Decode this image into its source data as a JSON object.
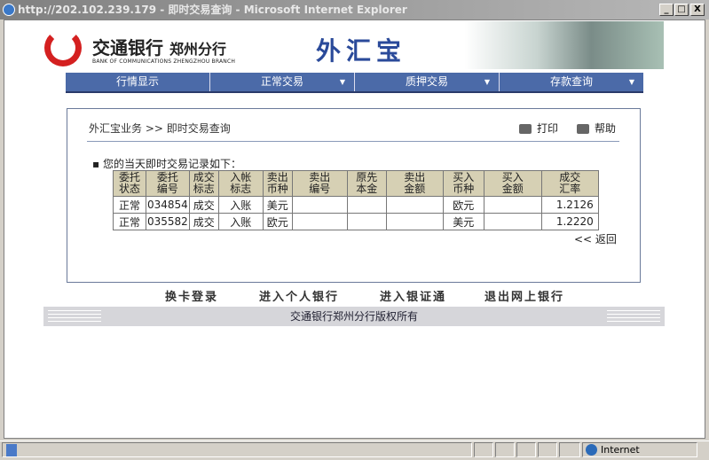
{
  "window": {
    "title": "http://202.102.239.179 - 即时交易查询 - Microsoft Internet Explorer",
    "buttons": {
      "minimize": "_",
      "maximize": "□",
      "close": "X"
    }
  },
  "header": {
    "bank_cn": "交通银行",
    "branch_cn": "郑州分行",
    "bank_en": "BANK OF COMMUNICATIONS ZHENGZHOU BRANCH",
    "product": "外汇宝"
  },
  "nav": [
    {
      "label": "行情显示"
    },
    {
      "label": "正常交易",
      "arrow": "▼"
    },
    {
      "label": "质押交易",
      "arrow": "▼"
    },
    {
      "label": "存款查询",
      "arrow": "▼"
    }
  ],
  "breadcrumb": "外汇宝业务 >> 即时交易查询",
  "actions": {
    "print": "打印",
    "help": "帮助"
  },
  "intro": "▪ 您的当天即时交易记录如下：",
  "table": {
    "headers": [
      [
        "委托",
        "状态"
      ],
      [
        "委托",
        "编号"
      ],
      [
        "成交",
        "标志"
      ],
      [
        "入帐",
        "标志"
      ],
      [
        "卖出",
        "币种"
      ],
      [
        "卖出",
        "编号"
      ],
      [
        "原先",
        "本金"
      ],
      [
        "卖出",
        "金额"
      ],
      [
        "买入",
        "币种"
      ],
      [
        "买入",
        "金额"
      ],
      [
        "成交",
        "汇率"
      ]
    ],
    "rows": [
      [
        "正常",
        "034854",
        "成交",
        "入账",
        "美元",
        "",
        "",
        "",
        "欧元",
        "",
        "1.2126"
      ],
      [
        "正常",
        "035582",
        "成交",
        "入账",
        "欧元",
        "",
        "",
        "",
        "美元",
        "",
        "1.2220"
      ]
    ]
  },
  "back": "<< 返回",
  "bottom_links": [
    "换卡登录",
    "进入个人银行",
    "进入银证通",
    "退出网上银行"
  ],
  "footer": "交通银行郑州分行版权所有",
  "status": {
    "zone": "Internet"
  }
}
